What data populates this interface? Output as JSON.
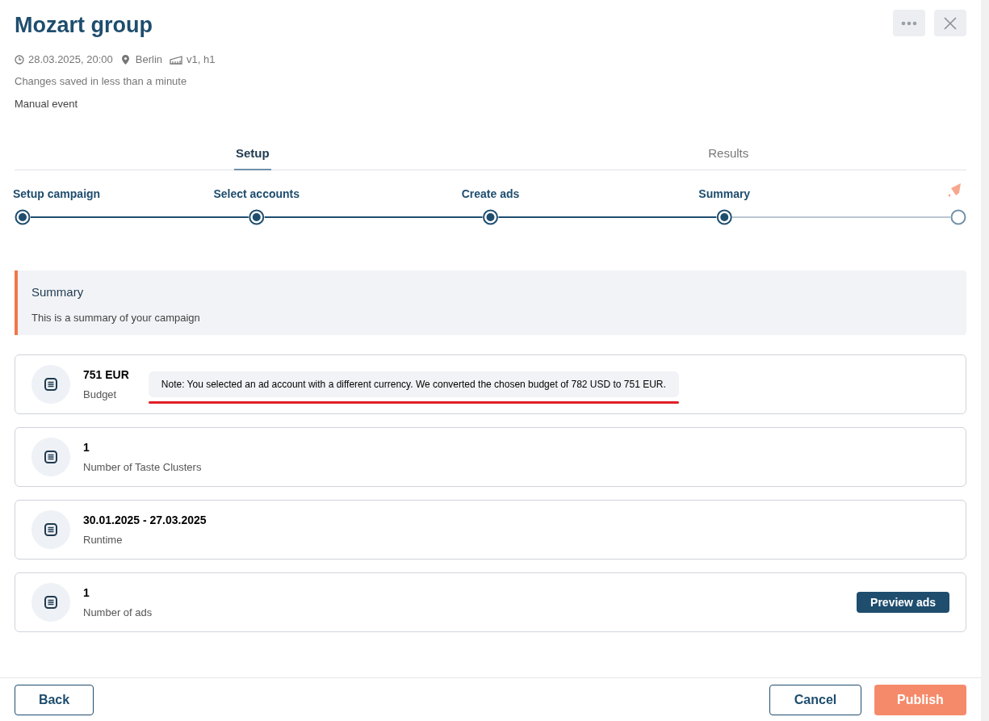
{
  "header": {
    "title": "Mozart group",
    "date": "28.03.2025, 20:00",
    "location": "Berlin",
    "venue": "v1, h1",
    "save_status": "Changes saved in less than a minute",
    "event_type": "Manual event"
  },
  "tabs": [
    {
      "label": "Setup",
      "selected": true
    },
    {
      "label": "Results",
      "selected": false
    }
  ],
  "steps": [
    {
      "label": "Setup campaign",
      "completed": true
    },
    {
      "label": "Select accounts",
      "completed": true
    },
    {
      "label": "Create ads",
      "completed": true
    },
    {
      "label": "Summary",
      "completed": true
    },
    {
      "kind": "finish",
      "completed": false
    }
  ],
  "info_box": {
    "title": "Summary",
    "text": "This is a summary of your campaign"
  },
  "summary_items": [
    {
      "value": "751 EUR",
      "label": "Budget",
      "note": "Note: You selected an ad account with a different currency. We converted the chosen budget of 782 USD to 751 EUR.",
      "note_underlined": true
    },
    {
      "value": "1",
      "label": "Number of Taste Clusters"
    },
    {
      "value": "30.01.2025 - 27.03.2025",
      "label": "Runtime"
    },
    {
      "value": "1",
      "label": "Number of ads",
      "action": "Preview ads"
    }
  ],
  "footer": {
    "back": "Back",
    "cancel": "Cancel",
    "publish": "Publish"
  }
}
